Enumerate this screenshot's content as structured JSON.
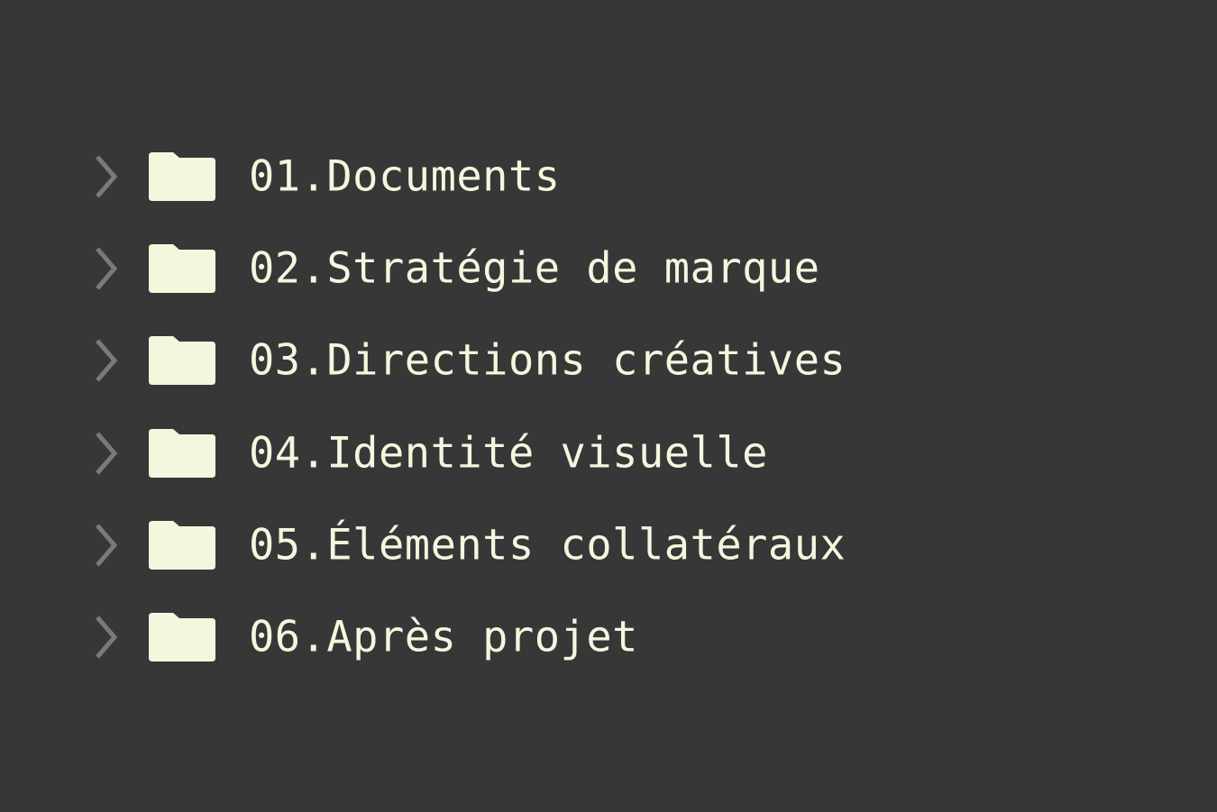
{
  "colors": {
    "background": "#373737",
    "folder": "#f4f6de",
    "label": "#f4f6de",
    "chevron": "#7a7a7a"
  },
  "icons": {
    "expander": "chevron-right-icon",
    "item": "folder-icon"
  },
  "folders": [
    {
      "label": "01.Documents"
    },
    {
      "label": "02.Stratégie de marque"
    },
    {
      "label": "03.Directions créatives"
    },
    {
      "label": "04.Identité visuelle"
    },
    {
      "label": "05.Éléments collatéraux"
    },
    {
      "label": "06.Après projet"
    }
  ]
}
